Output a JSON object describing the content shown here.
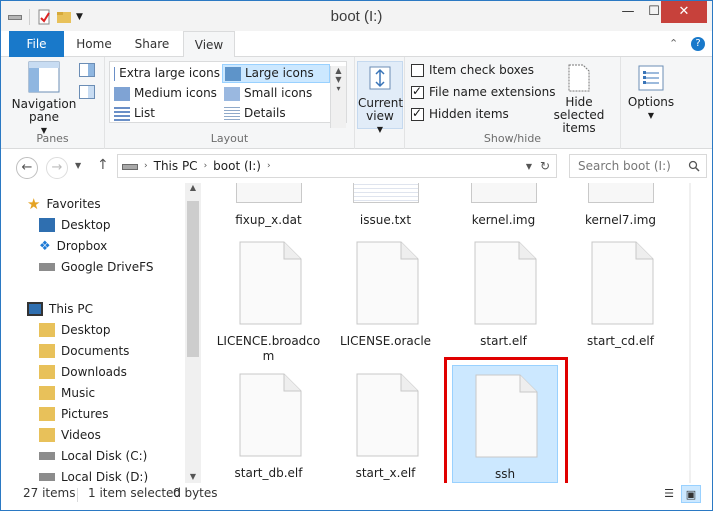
{
  "window": {
    "title": "boot (I:)",
    "close_glyph": "✕",
    "min_glyph": "—",
    "max_glyph": "☐"
  },
  "ribbon_tabs": {
    "file": "File",
    "home": "Home",
    "share": "Share",
    "view": "View",
    "collapse_glyph": "⌃",
    "help_glyph": "?"
  },
  "ribbon": {
    "panes": {
      "label": "Panes",
      "navigation_pane": "Navigation pane"
    },
    "layout": {
      "label": "Layout",
      "items": [
        "Extra large icons",
        "Large icons",
        "Medium icons",
        "Small icons",
        "List",
        "Details"
      ],
      "selected": "Large icons"
    },
    "current_view": {
      "label": "Current view"
    },
    "show_hide": {
      "label": "Show/hide",
      "item_check_boxes": "Item check boxes",
      "file_name_extensions": "File name extensions",
      "hidden_items": "Hidden items",
      "hide_selected_items": "Hide selected items",
      "item_check_boxes_checked": false,
      "file_name_extensions_checked": true,
      "hidden_items_checked": true
    },
    "options": {
      "label": "Options"
    }
  },
  "address_bar": {
    "breadcrumb": [
      "This PC",
      "boot (I:)"
    ],
    "search_placeholder": "Search boot (I:)"
  },
  "nav_pane": {
    "favorites": "Favorites",
    "favorites_items": [
      "Desktop",
      "Dropbox",
      "Google DriveFS"
    ],
    "this_pc": "This PC",
    "this_pc_items": [
      "Desktop",
      "Documents",
      "Downloads",
      "Music",
      "Pictures",
      "Videos",
      "Local Disk (C:)",
      "Local Disk (D:)"
    ]
  },
  "files": [
    {
      "name": "fixup_x.dat"
    },
    {
      "name": "issue.txt"
    },
    {
      "name": "kernel.img"
    },
    {
      "name": "kernel7.img"
    },
    {
      "name": "LICENCE.broadcom"
    },
    {
      "name": "LICENSE.oracle"
    },
    {
      "name": "start.elf"
    },
    {
      "name": "start_cd.elf"
    },
    {
      "name": "start_db.elf"
    },
    {
      "name": "start_x.elf"
    },
    {
      "name": "ssh"
    }
  ],
  "status": {
    "items_count": "27 items",
    "selected": "1 item selected",
    "size": "0 bytes"
  },
  "colors": {
    "accent": "#1979ca",
    "selection": "#cce8ff",
    "highlight": "#e00000"
  }
}
